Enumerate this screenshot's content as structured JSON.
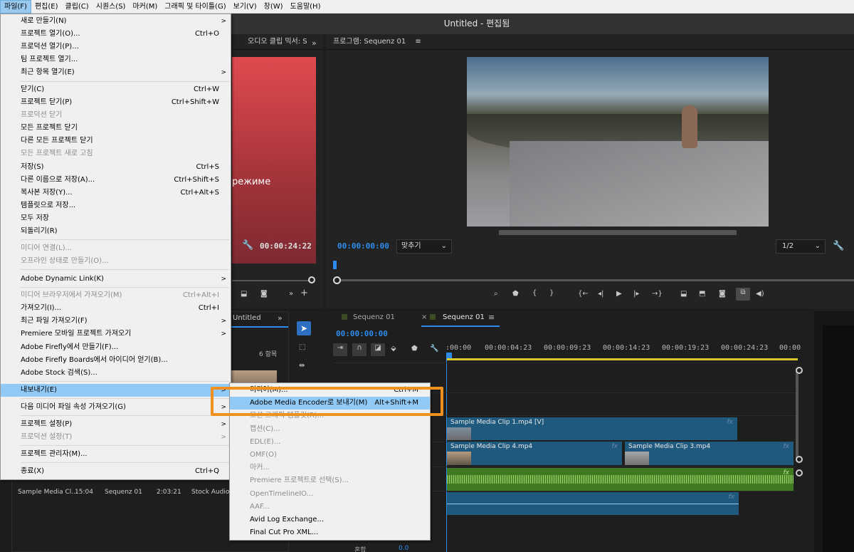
{
  "menubar": [
    "파일(F)",
    "편집(E)",
    "클립(C)",
    "시퀀스(S)",
    "마커(M)",
    "그래픽 및 타이틀(G)",
    "보기(V)",
    "창(W)",
    "도움말(H)"
  ],
  "window_title": "Untitled - 편집됨",
  "source_panel": {
    "title": "오디오 클립 믹서: S",
    "overlay_text": "режиме",
    "timecode": "00:00:24:22"
  },
  "program_panel": {
    "title": "프로그램: Sequenz 01",
    "timecode": "00:00:00:00",
    "fit": "맞추기",
    "resolution": "1/2"
  },
  "project_panel": {
    "tab": "Untitled",
    "count": "6 항목",
    "items": [
      {
        "name": "Sample Media Cl...",
        "dur": "15:04"
      },
      {
        "name": "Sequenz 01",
        "dur": "2:03:21"
      },
      {
        "name": "Stock Audio N",
        "dur": ""
      }
    ]
  },
  "timeline": {
    "tabs": [
      "Sequenz 01",
      "Sequenz 01"
    ],
    "timecode": "00:00:00:00",
    "ruler": [
      ":00:00",
      "00:00:04:23",
      "00:00:09:23",
      "00:00:14:23",
      "00:00:19:23",
      "00:00:24:23",
      "00:00"
    ],
    "clips": {
      "v2": "Sample Media Clip 1.mp4 [V]",
      "v1a": "Sample Media Clip 4.mp4",
      "v1b": "Sample Media Clip 3.mp4",
      "fx": "fx"
    },
    "footer_label": "혼합",
    "footer_value": "0.0"
  },
  "file_menu": {
    "items": [
      {
        "label": "새로 만들기(N)",
        "sc": "",
        "sub": true,
        "dis": false
      },
      {
        "label": "프로젝트 열기(O)...",
        "sc": "Ctrl+O",
        "sub": false,
        "dis": false
      },
      {
        "label": "프로덕션 열기(P)...",
        "sc": "",
        "sub": false,
        "dis": false
      },
      {
        "label": "팀 프로젝트 열기...",
        "sc": "",
        "sub": false,
        "dis": false
      },
      {
        "label": "최근 항목 열기(E)",
        "sc": "",
        "sub": true,
        "dis": false
      },
      {
        "label": "닫기(C)",
        "sc": "Ctrl+W",
        "sub": false,
        "dis": false
      },
      {
        "label": "프로젝트 닫기(P)",
        "sc": "Ctrl+Shift+W",
        "sub": false,
        "dis": false
      },
      {
        "label": "프로덕션 닫기",
        "sc": "",
        "sub": false,
        "dis": true
      },
      {
        "label": "모든 프로젝트 닫기",
        "sc": "",
        "sub": false,
        "dis": false
      },
      {
        "label": "다른 모든 프로젝트 닫기",
        "sc": "",
        "sub": false,
        "dis": false
      },
      {
        "label": "모든 프로젝트 새로 고침",
        "sc": "",
        "sub": false,
        "dis": true
      },
      {
        "label": "저장(S)",
        "sc": "Ctrl+S",
        "sub": false,
        "dis": false
      },
      {
        "label": "다른 이름으로 저장(A)...",
        "sc": "Ctrl+Shift+S",
        "sub": false,
        "dis": false
      },
      {
        "label": "복사본 저장(Y)...",
        "sc": "Ctrl+Alt+S",
        "sub": false,
        "dis": false
      },
      {
        "label": "템플릿으로 저장...",
        "sc": "",
        "sub": false,
        "dis": false
      },
      {
        "label": "모두 저장",
        "sc": "",
        "sub": false,
        "dis": false
      },
      {
        "label": "되돌리기(R)",
        "sc": "",
        "sub": false,
        "dis": false
      },
      {
        "label": "미디어 연결(L)...",
        "sc": "",
        "sub": false,
        "dis": true
      },
      {
        "label": "오프라인 상태로 만들기(O)...",
        "sc": "",
        "sub": false,
        "dis": true
      },
      {
        "label": "Adobe Dynamic Link(K)",
        "sc": "",
        "sub": true,
        "dis": false
      },
      {
        "label": "미디어 브라우저에서 가져오기(M)",
        "sc": "Ctrl+Alt+I",
        "sub": false,
        "dis": true
      },
      {
        "label": "가져오기(I)...",
        "sc": "Ctrl+I",
        "sub": false,
        "dis": false
      },
      {
        "label": "최근 파일 가져오기(F)",
        "sc": "",
        "sub": true,
        "dis": false
      },
      {
        "label": "Premiere 모바일 프로젝트 가져오기",
        "sc": "",
        "sub": true,
        "dis": false
      },
      {
        "label": "Adobe Firefly에서 만들기(F)...",
        "sc": "",
        "sub": false,
        "dis": false
      },
      {
        "label": "Adobe Firefly Boards에서 아이디어 얻기(B)...",
        "sc": "",
        "sub": false,
        "dis": false
      },
      {
        "label": "Adobe Stock 검색(S)...",
        "sc": "",
        "sub": false,
        "dis": false
      },
      {
        "label": "내보내기(E)",
        "sc": "",
        "sub": true,
        "dis": false
      },
      {
        "label": "다음 미디어 파일 속성 가져오기(G)",
        "sc": "",
        "sub": true,
        "dis": false
      },
      {
        "label": "프로젝트 설정(P)",
        "sc": "",
        "sub": true,
        "dis": false
      },
      {
        "label": "프로덕션 설정(T)",
        "sc": "",
        "sub": true,
        "dis": true
      },
      {
        "label": "프로젝트 관리자(M)...",
        "sc": "",
        "sub": false,
        "dis": false
      },
      {
        "label": "종료(X)",
        "sc": "Ctrl+Q",
        "sub": false,
        "dis": false
      }
    ]
  },
  "export_menu": {
    "items": [
      {
        "label": "미디어(M)...",
        "sc": "Ctrl+M",
        "dis": false
      },
      {
        "label": "Adobe Media Encoder로 보내기(M)",
        "sc": "Alt+Shift+M",
        "dis": false
      },
      {
        "label": "모션 그래픽 템플릿(R)...",
        "sc": "",
        "dis": true
      },
      {
        "label": "캡션(C)...",
        "sc": "",
        "dis": true
      },
      {
        "label": "EDL(E)...",
        "sc": "",
        "dis": true
      },
      {
        "label": "OMF(O)",
        "sc": "",
        "dis": true
      },
      {
        "label": "마커...",
        "sc": "",
        "dis": true
      },
      {
        "label": "Premiere 프로젝트로 선택(S)...",
        "sc": "",
        "dis": true
      },
      {
        "label": "OpenTimelineIO...",
        "sc": "",
        "dis": true
      },
      {
        "label": "AAF...",
        "sc": "",
        "dis": true
      },
      {
        "label": "Avid Log Exchange...",
        "sc": "",
        "dis": false
      },
      {
        "label": "Final Cut Pro XML...",
        "sc": "",
        "dis": false
      }
    ]
  },
  "colors": {
    "highlight": "#91c9f7",
    "callout": "#f0901e",
    "video_clip": "#1f5a7e",
    "audio_clip": "#3f7a22",
    "timecode": "#2d8ceb"
  }
}
